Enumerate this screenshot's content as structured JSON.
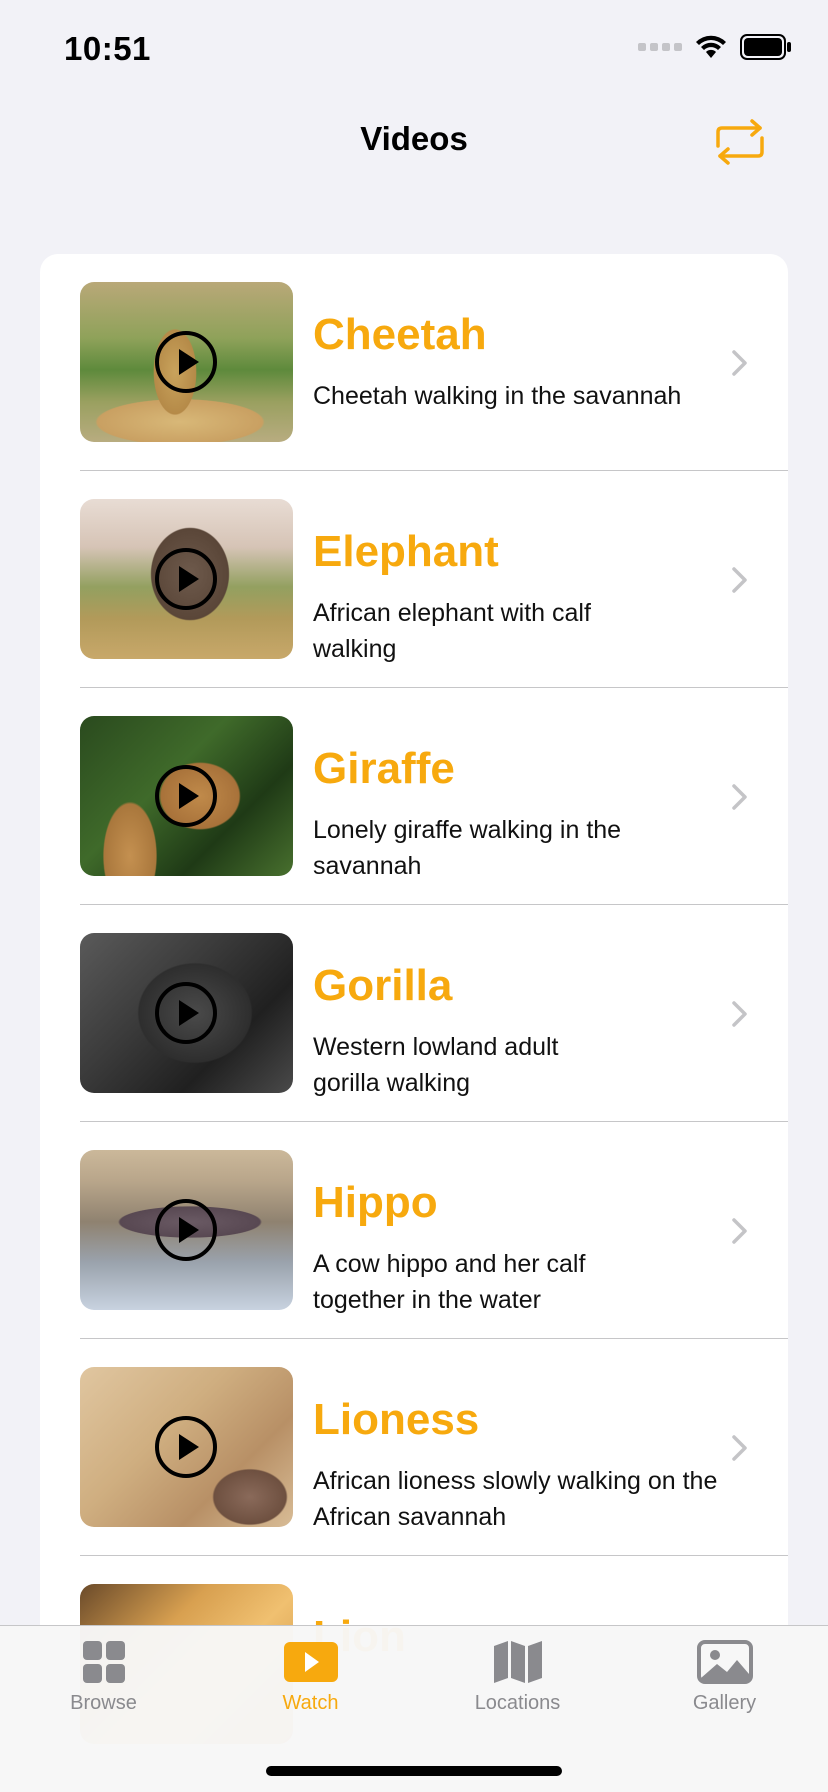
{
  "status_bar": {
    "time": "10:51"
  },
  "nav": {
    "title": "Videos",
    "refresh_icon": "repeat-arrows-icon"
  },
  "colors": {
    "accent": "#f7a90e",
    "background": "#f2f2f7",
    "inactive": "#8a8a8e"
  },
  "videos": [
    {
      "title": "Cheetah",
      "description": "Cheetah walking in the savannah"
    },
    {
      "title": "Elephant",
      "description": "African elephant with calf walking"
    },
    {
      "title": "Giraffe",
      "description": "Lonely giraffe walking in the savannah"
    },
    {
      "title": "Gorilla",
      "description": "Western lowland adult gorilla walking"
    },
    {
      "title": "Hippo",
      "description": "A cow hippo and her calf together in the water"
    },
    {
      "title": "Lioness",
      "description": "African lioness slowly walking on the African savannah"
    },
    {
      "title": "Lion",
      "description": ""
    }
  ],
  "tabs": [
    {
      "label": "Browse",
      "icon": "grid-icon",
      "active": false
    },
    {
      "label": "Watch",
      "icon": "play-rectangle-icon",
      "active": true
    },
    {
      "label": "Locations",
      "icon": "map-icon",
      "active": false
    },
    {
      "label": "Gallery",
      "icon": "photo-icon",
      "active": false
    }
  ]
}
